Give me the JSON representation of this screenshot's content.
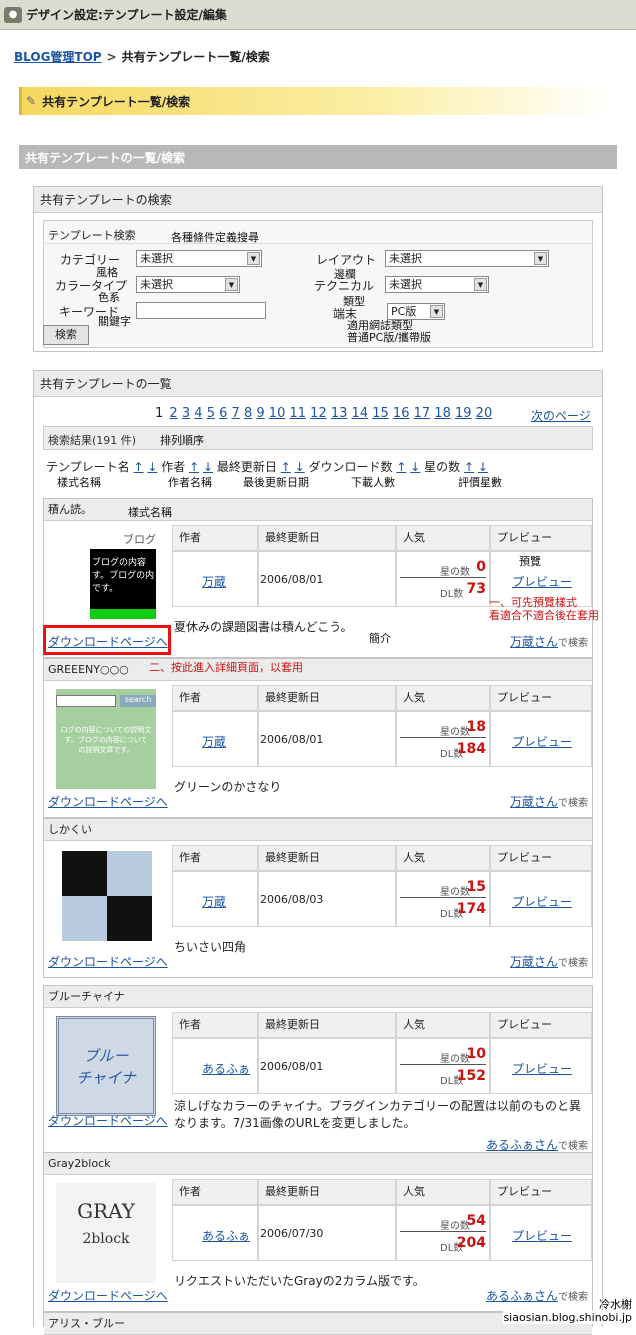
{
  "titlebar": {
    "title": "デザイン設定:テンプレート設定/編集"
  },
  "breadcrumb": {
    "home": "BLOG管理TOP",
    "sep": ">",
    "current": "共有テンプレート一覧/検索"
  },
  "section_title": "共有テンプレート一覧/検索",
  "list_bar": "共有テンプレートの一覧/検索",
  "search": {
    "panel_title": "共有テンプレートの検索",
    "sub_title": "テンプレート検索",
    "sub_ann": "各種條件定義搜尋",
    "category_label": "カテゴリー",
    "category_value": "未選択",
    "category_ann": "風格",
    "layout_label": "レイアウト",
    "layout_value": "未選択",
    "layout_ann": "邊欄",
    "color_label": "カラータイプ",
    "color_value": "未選択",
    "color_ann": "色系",
    "technical_label": "テクニカル",
    "technical_value": "未選択",
    "technical_ann": "類型",
    "keyword_label": "キーワード",
    "keyword_ann": "關鍵字",
    "keyword_value": "",
    "device_label": "端末",
    "device_value": "PC版",
    "device_ann1": "適用網誌類型",
    "device_ann2": "普通PC版/攜帶版",
    "search_button": "検索"
  },
  "list": {
    "panel_title": "共有テンプレートの一覧",
    "pages": [
      "1",
      "2",
      "3",
      "4",
      "5",
      "6",
      "7",
      "8",
      "9",
      "10",
      "11",
      "12",
      "13",
      "14",
      "15",
      "16",
      "17",
      "18",
      "19",
      "20"
    ],
    "next_page": "次のページ",
    "result_label": "検索結果(191 件)",
    "sort_ann": {
      "name": "樣式名稱",
      "author": "作者名稱",
      "updated": "最後更新日期",
      "downloads": "下載人數",
      "stars": "評價星數"
    },
    "sort": {
      "name": "テンプレート名",
      "author": "作者",
      "updated": "最終更新日",
      "downloads": "ダウンロード数",
      "stars": "星の数",
      "up": "↑",
      "down": "↓"
    }
  },
  "cols": {
    "author": "作者",
    "updated": "最終更新日",
    "popular": "人気",
    "preview": "プレビュー",
    "stars_label": "星の数",
    "dl_label": "DL数",
    "preview_link": "プレビュー",
    "download_link": "ダウンロードページへ",
    "search_suffix": "で検索"
  },
  "annotations": {
    "name_ann": "樣式名稱",
    "preview_ann": "預覽",
    "preview_note1": "一、可先預覽樣式",
    "preview_note2": "看適合不適合後在套用",
    "summary_ann": "簡介",
    "download_note": "二、按此進入詳細頁面，以套用",
    "watermark1": "冷水榭",
    "watermark2": "siaosian.blog.shinobi.jp"
  },
  "entries": [
    {
      "name": "積ん読。",
      "author": "万蔵",
      "date": "2006/08/01",
      "stars": "0",
      "dl": "73",
      "desc": "夏休みの課題図書は積んどこう。",
      "search": "万蔵さん",
      "thumb_label": "ブログ",
      "thumb_text": "ブログの内容\nす。ブログの内\nです。"
    },
    {
      "name": "GREEENY○○○",
      "author": "万蔵",
      "date": "2006/08/01",
      "stars": "18",
      "dl": "184",
      "desc": "グリーンのかさなり",
      "search": "万蔵さん",
      "thumb_label": "search",
      "thumb_text": "ログの内容についての説明文\nす。ブログの内容について\nの説明文章です。"
    },
    {
      "name": "しかくい",
      "author": "万蔵",
      "date": "2006/08/03",
      "stars": "15",
      "dl": "174",
      "desc": "ちいさい四角",
      "search": "万蔵さん"
    },
    {
      "name": "ブルーチャイナ",
      "author": "あるふぁ",
      "date": "2006/08/01",
      "stars": "10",
      "dl": "152",
      "desc": "涼しげなカラーのチャイナ。プラグインカテゴリーの配置は以前のものと異なります。7/31画像のURLを変更しました。",
      "search": "あるふぁさん",
      "thumb_text": "ブルー\nチャイナ"
    },
    {
      "name": "Gray2block",
      "author": "あるふぁ",
      "date": "2006/07/30",
      "stars": "54",
      "dl": "204",
      "desc": "リクエストいただいたGrayの2カラム版です。",
      "search": "あるふぁさん",
      "thumb_text": "GRAY",
      "thumb_text2": "2block"
    },
    {
      "name": "アリス・ブルー"
    }
  ],
  "colors": {
    "link": "#1a55a0",
    "star_red": "#cc1111",
    "title_bar": "#dcdcd0",
    "gray_bar": "#b8b8b8"
  }
}
